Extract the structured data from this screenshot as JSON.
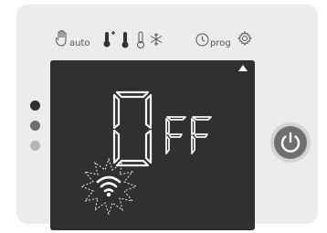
{
  "mode_bar": {
    "auto_label": "auto",
    "prog_label": "prog",
    "icons": [
      "hand-icon",
      "thermometer-plus-icon",
      "thermometer-filled-icon",
      "thermometer-empty-icon",
      "snowflake-icon",
      "clock-icon",
      "gear-icon"
    ]
  },
  "display": {
    "status_big": "O",
    "status_small": "FF",
    "arrow_icon": "up-triangle-icon",
    "wifi_icon": "wifi-burst-icon"
  },
  "indicators": {
    "dots": [
      "dot-1",
      "dot-2",
      "dot-3"
    ]
  },
  "power": {
    "icon": "power-icon"
  },
  "colors": {
    "panel": "#ececec",
    "display_bg": "#2f302f",
    "segment": "#f7f7f7",
    "power_button": "#6f6f6f"
  }
}
